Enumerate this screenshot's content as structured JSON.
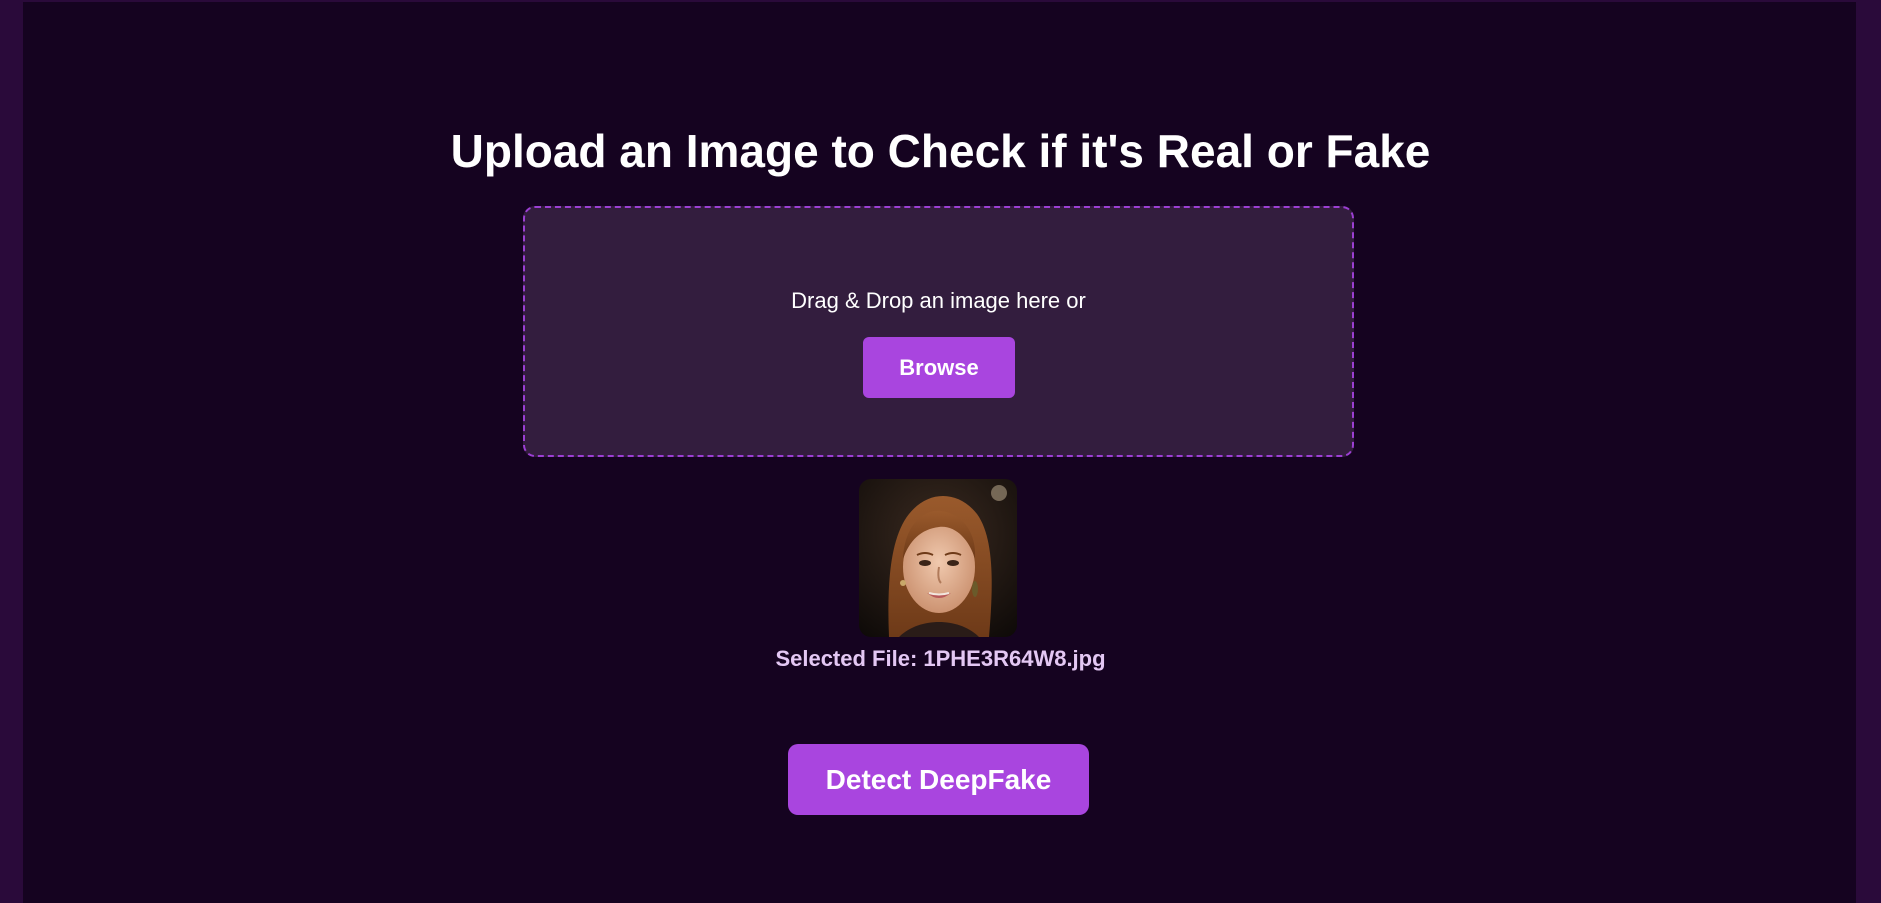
{
  "page": {
    "title": "Upload an Image to Check if it's Real or Fake"
  },
  "dropzone": {
    "prompt": "Drag & Drop an image here or",
    "browse_label": "Browse"
  },
  "preview": {
    "selected_file_label": "Selected File: 1PHE3R64W8.jpg"
  },
  "actions": {
    "detect_label": "Detect DeepFake"
  },
  "colors": {
    "page_background": "#150320",
    "outer_background": "#2a0a3a",
    "dropzone_background": "#331d3e",
    "dropzone_border": "#9c3fd3",
    "accent": "#a945df",
    "selected_file_text": "#e3c7f3"
  }
}
